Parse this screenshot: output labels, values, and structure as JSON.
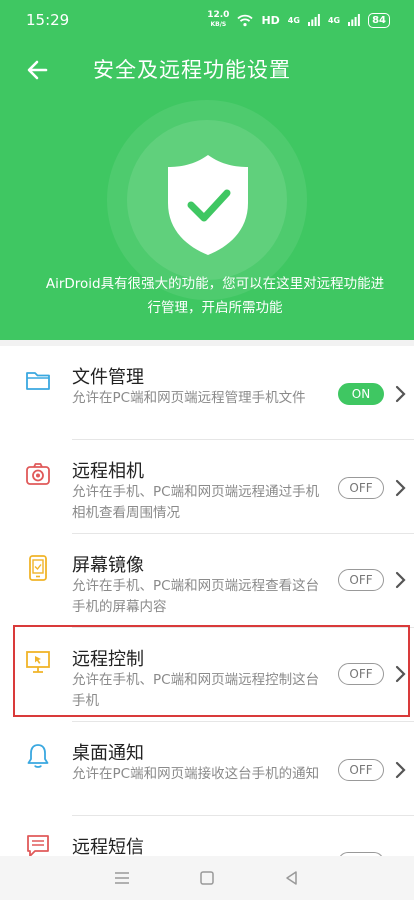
{
  "status_bar": {
    "time": "15:29",
    "net_speed_value": "12.0",
    "net_speed_unit": "KB/S",
    "hd_label": "HD",
    "signal_1_label": "4G",
    "signal_2_label": "4G",
    "battery": "84"
  },
  "header": {
    "title": "安全及远程功能设置",
    "description": "AirDroid具有很强大的功能，您可以在这里对远程功能进行管理，开启所需功能"
  },
  "features": [
    {
      "icon": "folder-icon",
      "title": "文件管理",
      "description": "允许在PC端和网页端远程管理手机文件",
      "toggle": "ON",
      "enabled": true
    },
    {
      "icon": "camera-icon",
      "title": "远程相机",
      "description": "允许在手机、PC端和网页端远程通过手机相机查看周围情况",
      "toggle": "OFF",
      "enabled": false
    },
    {
      "icon": "screen-mirror-icon",
      "title": "屏幕镜像",
      "description": "允许在手机、PC端和网页端远程查看这台手机的屏幕内容",
      "toggle": "OFF",
      "enabled": false
    },
    {
      "icon": "remote-control-icon",
      "title": "远程控制",
      "description": "允许在手机、PC端和网页端远程控制这台手机",
      "toggle": "OFF",
      "enabled": false
    },
    {
      "icon": "bell-icon",
      "title": "桌面通知",
      "description": "允许在PC端和网页端接收这台手机的通知",
      "toggle": "OFF",
      "enabled": false
    },
    {
      "icon": "message-icon",
      "title": "远程短信",
      "description": "",
      "toggle": "",
      "enabled": false
    }
  ],
  "colors": {
    "accent_green": "#3fc762",
    "highlight_red": "#d93a3a",
    "icon_blue": "#3aa8e0",
    "icon_red": "#e05a5a",
    "icon_yellow": "#f0b429"
  }
}
